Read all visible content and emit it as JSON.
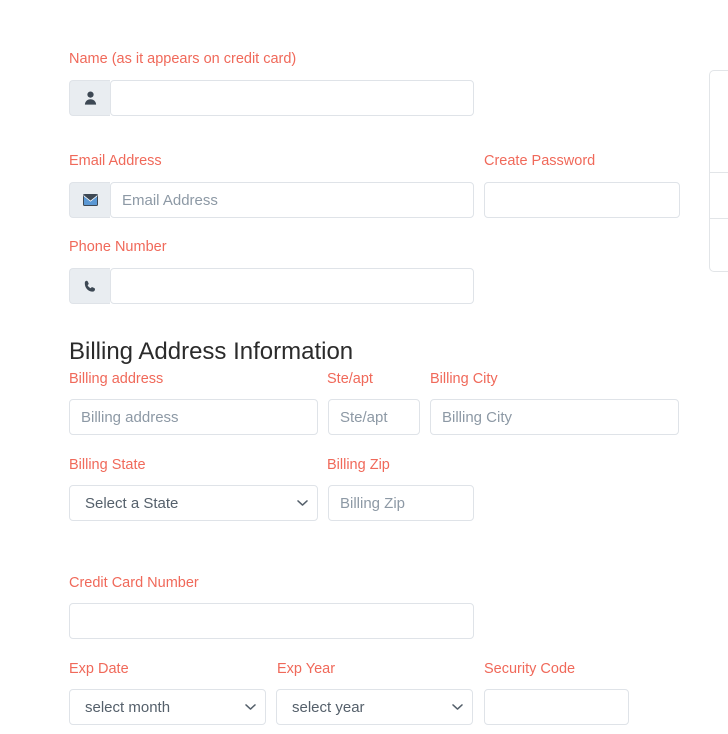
{
  "form": {
    "name_section": {
      "label": "Name (as it appears on credit card)",
      "icon": "user-icon",
      "value": "",
      "placeholder": ""
    },
    "email": {
      "label": "Email Address",
      "icon": "envelope-icon",
      "value": "",
      "placeholder": "Email Address"
    },
    "password": {
      "label": "Create Password",
      "value": "",
      "placeholder": ""
    },
    "phone": {
      "label": "Phone Number",
      "icon": "phone-icon",
      "value": "",
      "placeholder": ""
    },
    "billing_heading": "Billing Address Information",
    "billing_address": {
      "label": "Billing address",
      "value": "",
      "placeholder": "Billing address"
    },
    "suite_apt": {
      "label": "Ste/apt",
      "value": "",
      "placeholder": "Ste/apt"
    },
    "billing_city": {
      "label": "Billing City",
      "value": "",
      "placeholder": "Billing City"
    },
    "billing_state": {
      "label": "Billing State",
      "selected": "Select a State",
      "options": [
        "Select a State"
      ],
      "icon": "chevron-down-icon"
    },
    "billing_zip": {
      "label": "Billing Zip",
      "value": "",
      "placeholder": "Billing Zip"
    },
    "credit_card_number": {
      "label": "Credit Card Number",
      "value": "",
      "placeholder": ""
    },
    "exp_date": {
      "label": "Exp Date",
      "selected": "select month",
      "options": [
        "select month"
      ],
      "icon": "chevron-down-icon"
    },
    "exp_year": {
      "label": "Exp Year",
      "selected": "select year",
      "options": [
        "select year"
      ],
      "icon": "chevron-down-icon"
    },
    "security_code": {
      "label": "Security Code",
      "value": "",
      "placeholder": ""
    }
  },
  "colors": {
    "label": "#f0695a",
    "heading": "#2b2b2b",
    "border": "#dfe3e8",
    "addon_bg": "#e9edf1",
    "placeholder": "#8d99a5"
  }
}
